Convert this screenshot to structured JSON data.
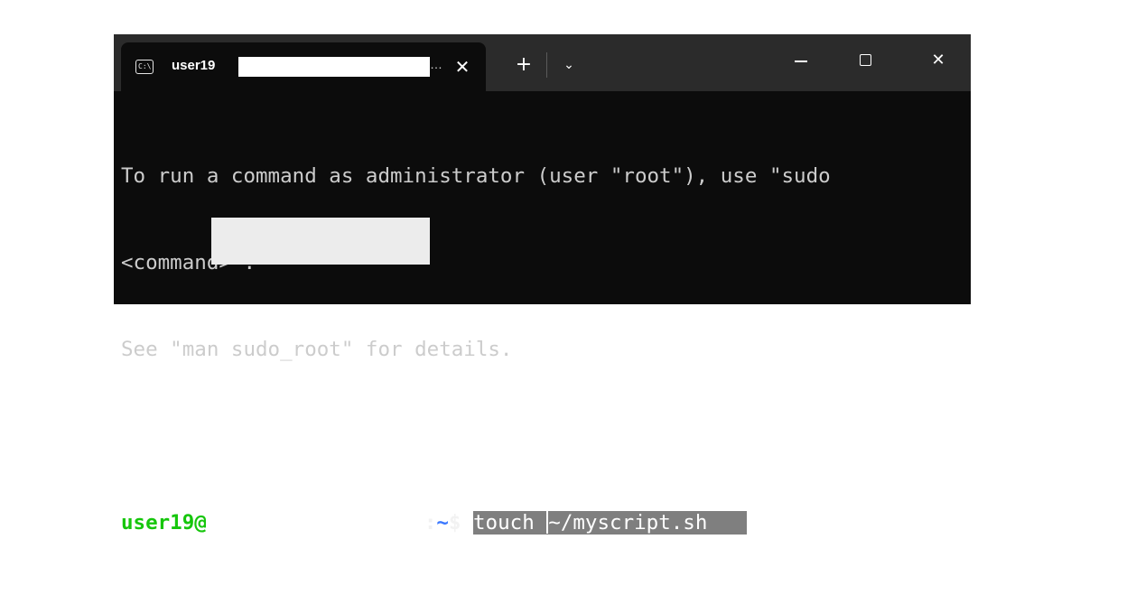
{
  "window": {
    "tab_title_visible": "user19",
    "tab_title_ellipsis": "…",
    "tab_icon_text": "C:\\",
    "tab_close_glyph": "✕",
    "new_tab_glyph": "+",
    "dropdown_glyph": "⌄",
    "minimize_glyph": "—",
    "maximize_glyph": "☐",
    "close_glyph": "✕"
  },
  "terminal": {
    "lines": [
      "To run a command as administrator (user \"root\"), use \"sudo",
      "<command>\".",
      "See \"man sudo_root\" for details.",
      ""
    ],
    "prompt": {
      "user_host": "user19@",
      "path_prefix": ":",
      "path": "~",
      "dollar": "$ ",
      "command_before_cursor": "touch ",
      "command_after_cursor": "~/myscript.sh"
    }
  },
  "colors": {
    "terminal_bg": "#0c0c0c",
    "titlebar_bg": "#2b2b2b",
    "prompt_user": "#16c60c",
    "prompt_path": "#3b78ff",
    "selection": "#7f7f7f"
  }
}
